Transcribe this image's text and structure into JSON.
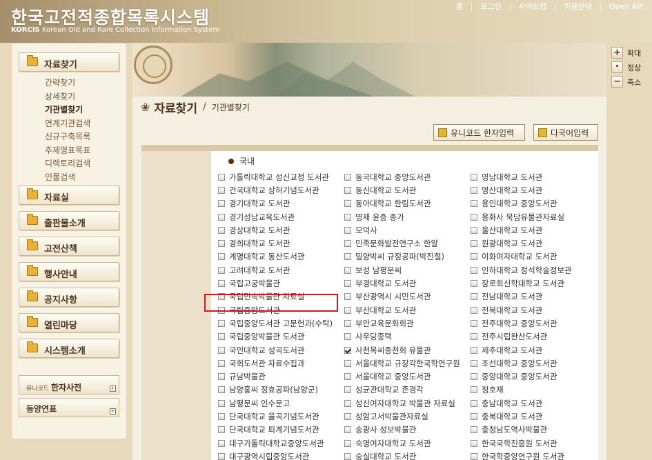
{
  "header": {
    "logo": "한국고전적종합목록시스템",
    "logo_sub_bold": "KORCIS",
    "logo_sub": "Korean Old and Rare Collection Information System"
  },
  "topnav": [
    "홈",
    "로그인",
    "사이트맵",
    "이용안내",
    "Open API"
  ],
  "sidebar": {
    "main_menu": "자료찾기",
    "sub_items": [
      "간략찾기",
      "상세찾기",
      "기관별찾기",
      "연계기관검색",
      "신규구축목록",
      "주제명표목표",
      "디렉토리검색",
      "인물검색"
    ],
    "menus": [
      "자료실",
      "출판물소개",
      "고전산책",
      "행사안내",
      "공지사항",
      "열린마당",
      "시스템소개"
    ],
    "hanja_small": "유니코드",
    "hanja_big": "한자사전",
    "dongyang": "동양연표"
  },
  "zoom": {
    "in": "확대",
    "normal": "정상",
    "out": "축소"
  },
  "page": {
    "title": "자료찾기",
    "breadcrumb": "기관별찾기"
  },
  "buttons": {
    "unicode": "유니코드 한자입력",
    "multilang": "다국어입력"
  },
  "section": "국내",
  "columns": [
    [
      "가톨릭대학교 성신교정 도서관",
      "건국대학교 상허기념도서관",
      "경기대학교 도서관",
      "경기성남교육도서관",
      "경상대학교 도서관",
      "경희대학교 도서관",
      "계명대학교 동산도서관",
      "고려대학교 도서관",
      "국립고궁박물관",
      "국립민속박물관 자료실",
      "국립중앙도서관",
      "국립중앙도서관 고문헌과(수탁)",
      "국립중앙박물관 도서관",
      "국민대학교 성곡도서관",
      "국회도서관 자료수집과",
      "규남박물관",
      "남양홍씨 정효공파(남양군)",
      "남평문씨 인수문고",
      "단국대학교 율곡기념도서관",
      "단국대학교 퇴계기념도서관",
      "대구가톨릭대학교중앙도서관",
      "대구광역시립중앙도서관"
    ],
    [
      "동국대학교 중앙도서관",
      "동신대학교 도서관",
      "동아대학교 한림도서관",
      "명재 윤증 종가",
      "모덕사",
      "민족문화발전연구소 한알",
      "밀양박씨 규정공파(박진철)",
      "보성 남평문씨",
      "부경대학교 도서관",
      "부산광역시 시민도서관",
      "부산대학교 도서관",
      "부안교육문화회관",
      "사우당종택",
      "사천목씨종천회 유물관",
      "서울대학교 규장각한국학연구원",
      "서울대학교 중앙도서관",
      "성균관대학교 존경각",
      "성신여자대학교 박물관 자료실",
      "성암고서박물관자료실",
      "송광사 성보박물관",
      "숙명여자대학교 도서관",
      "숭실대학교 도서관"
    ],
    [
      "영남대학교 도서관",
      "영산대학교 도서관",
      "용인대학교 중앙도서관",
      "용화사 묵담유물관자료실",
      "울산대학교 도서관",
      "원광대학교 도서관",
      "이화여자대학교 도서관",
      "인하대학교 정석학술정보관",
      "장로회신학대학교 도서관",
      "전남대학교 도서관",
      "전북대학교 도서관",
      "전주대학교 중앙도서관",
      "전주시립완산도서관",
      "제주대학교 도서관",
      "조선대학교 중앙도서관",
      "중앙대학교 중앙도서관",
      "청호재",
      "충남대학교 도서관",
      "충북대학교 도서관",
      "충청남도역사박물관",
      "한국국학진흥원 도서관",
      "한국학중앙연구원 도서관"
    ]
  ],
  "checked": {
    "col": 1,
    "row": 13
  }
}
